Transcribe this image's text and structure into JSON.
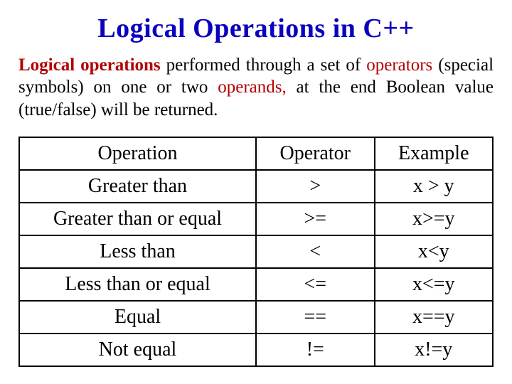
{
  "title": "Logical Operations in C++",
  "intro": {
    "lo": "Logical operations",
    "p1": " performed through a set of ",
    "operators": "operators",
    "p2": " (special symbols) on one or two ",
    "operands": "operands,",
    "p3": " at the end Boolean value (true/false)  will be returned."
  },
  "headers": {
    "c1": "Operation",
    "c2": "Operator",
    "c3": "Example"
  },
  "rows": [
    {
      "op": "Greater than",
      "sym": ">",
      "ex": "x > y"
    },
    {
      "op": "Greater than or equal",
      "sym": ">=",
      "ex": "x>=y"
    },
    {
      "op": "Less than",
      "sym": "<",
      "ex": "x<y"
    },
    {
      "op": "Less than or equal",
      "sym": "<=",
      "ex": "x<=y"
    },
    {
      "op": "Equal",
      "sym": "==",
      "ex": "x==y"
    },
    {
      "op": "Not equal",
      "sym": "!=",
      "ex": "x!=y"
    }
  ]
}
